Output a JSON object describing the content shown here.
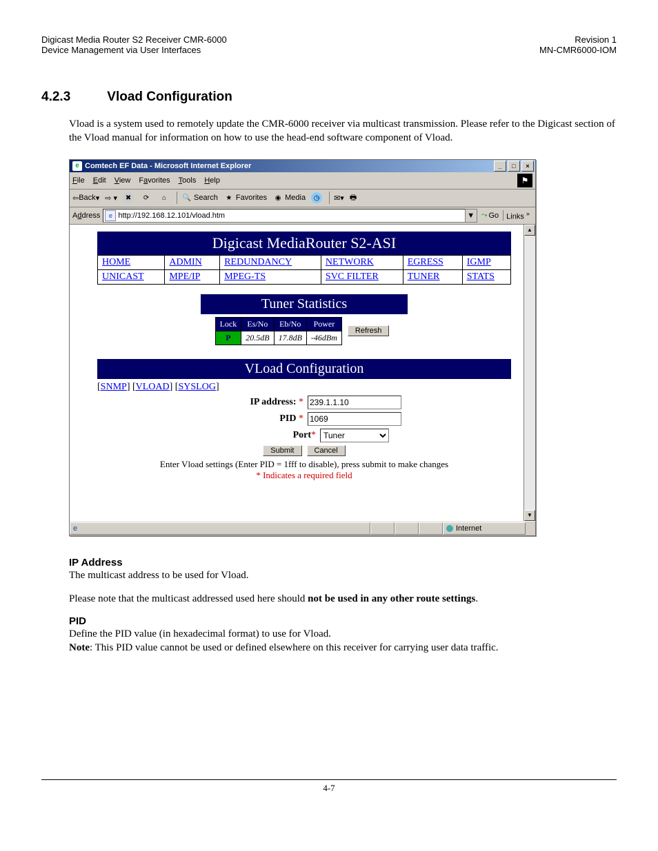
{
  "doc_header": {
    "left_line1": "Digicast Media Router S2 Receiver CMR-6000",
    "left_line2": "Device Management via User Interfaces",
    "right_line1": "Revision 1",
    "right_line2": "MN-CMR6000-IOM"
  },
  "section": {
    "number": "4.2.3",
    "title": "Vload Configuration"
  },
  "intro": "Vload is a system used to remotely update the CMR-6000 receiver via multicast transmission. Please refer to the Digicast section of the Vload manual for information on how to use the head-end software component of Vload.",
  "browser": {
    "title": "Comtech EF Data - Microsoft Internet Explorer",
    "menus": {
      "file": "File",
      "edit": "Edit",
      "view": "View",
      "favorites": "Favorites",
      "tools": "Tools",
      "help": "Help"
    },
    "toolbar": {
      "back": "Back",
      "forward": "",
      "stop": "",
      "refresh": "",
      "home": "",
      "search": "Search",
      "favs": "Favorites",
      "media": "Media"
    },
    "address_label": "Address",
    "url": "http://192.168.12.101/vload.htm",
    "go": "Go",
    "links": "Links",
    "status_zone": "Internet"
  },
  "page": {
    "banner": "Digicast MediaRouter S2-ASI",
    "nav": {
      "row1": [
        "HOME",
        "ADMIN",
        "REDUNDANCY",
        "NETWORK",
        "EGRESS",
        "IGMP"
      ],
      "row2": [
        "UNICAST",
        "MPE/IP",
        "MPEG-TS",
        "SVC FILTER",
        "TUNER",
        "STATS"
      ]
    },
    "tuner_stats": {
      "title": "Tuner Statistics",
      "headers": [
        "Lock",
        "Es/No",
        "Eb/No",
        "Power"
      ],
      "values": {
        "lock": "P",
        "esno": "20.5dB",
        "ebno": "17.8dB",
        "power": "-46dBm"
      },
      "refresh": "Refresh"
    },
    "vload": {
      "title": "VLoad Configuration",
      "sublinks": [
        "SNMP",
        "VLOAD",
        "SYSLOG"
      ],
      "fields": {
        "ip_label": "IP address:",
        "ip_value": "239.1.1.10",
        "pid_label": "PID",
        "pid_value": "1069",
        "port_label": "Port",
        "port_value": "Tuner"
      },
      "submit": "Submit",
      "cancel": "Cancel",
      "note1": "Enter Vload settings (Enter PID = 1fff to disable), press submit to make changes",
      "note2": "* Indicates a required field"
    }
  },
  "body_sections": {
    "ip_heading": "IP Address",
    "ip_p1": "The multicast address to be used for Vload.",
    "ip_p2a": "Please note that the multicast addressed used here should ",
    "ip_p2b": "not be used in any other route settings",
    "pid_heading": "PID",
    "pid_p1": "Define the PID value (in hexadecimal format) to use for Vload.",
    "pid_p2a": "Note",
    "pid_p2b": ": This PID value cannot be used or defined elsewhere on this receiver for carrying user data traffic."
  },
  "footer": "4-7"
}
